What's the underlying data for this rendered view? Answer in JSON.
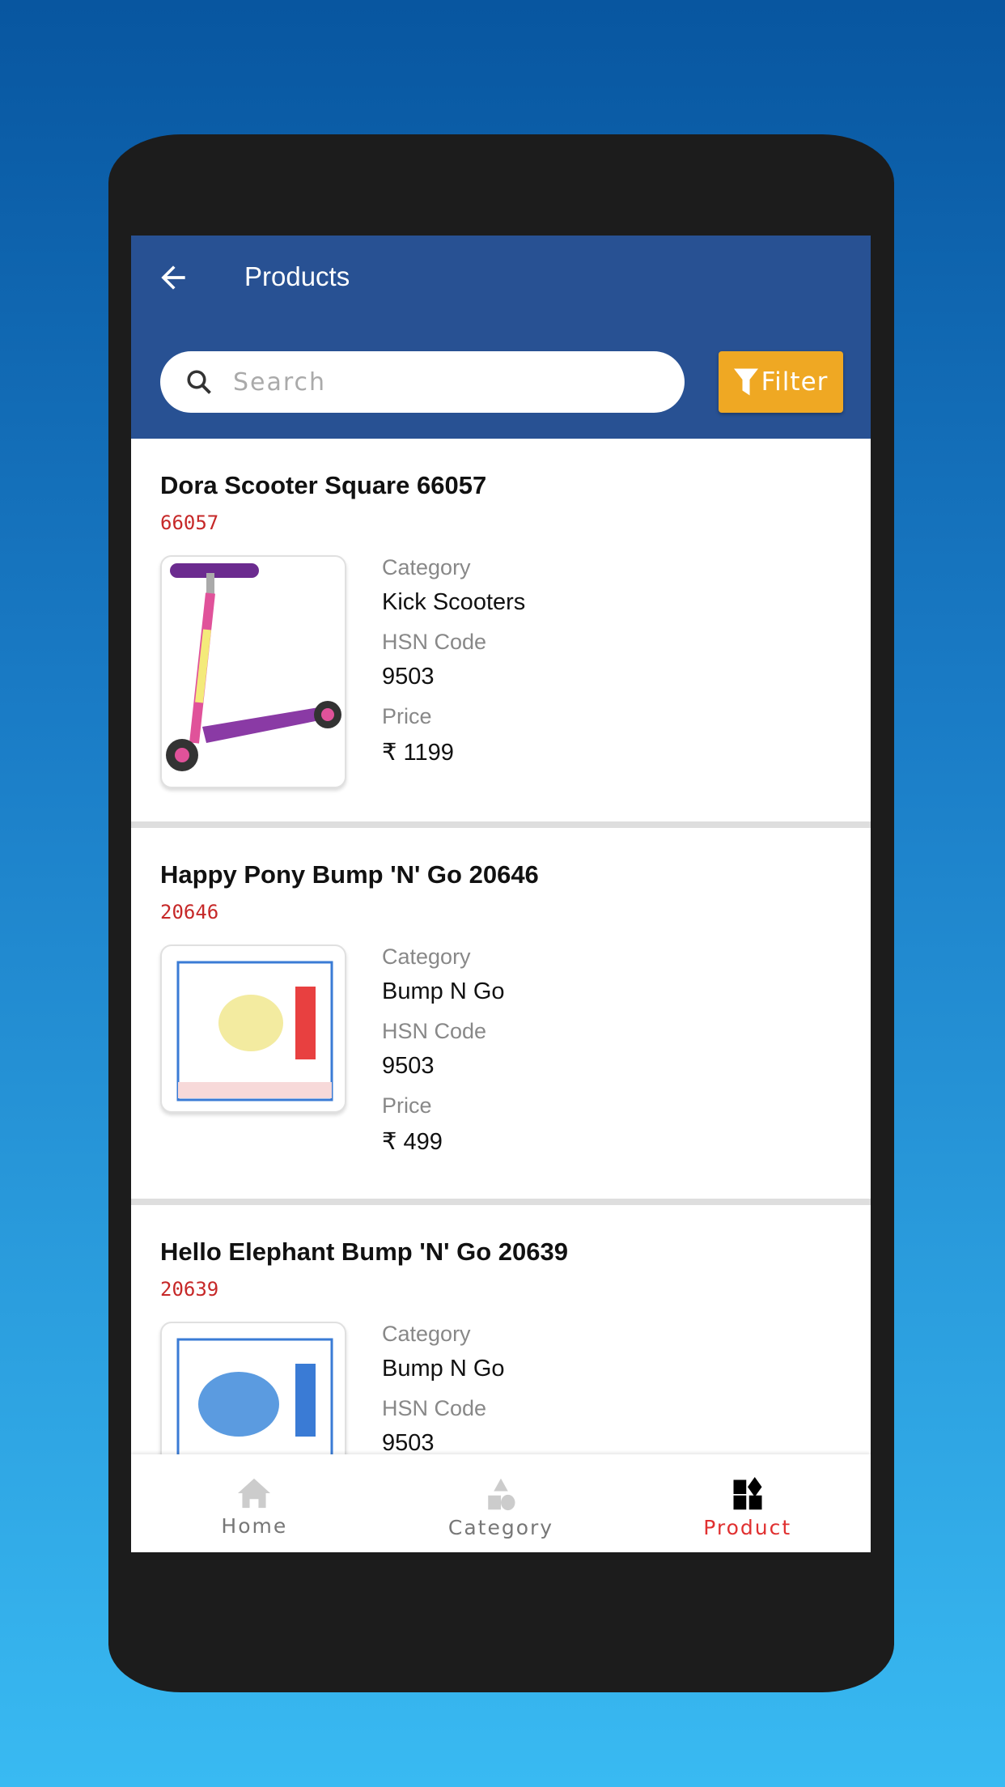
{
  "header": {
    "title": "Products",
    "back_icon": "arrow-left-icon"
  },
  "search": {
    "placeholder": "Search",
    "value": ""
  },
  "filter": {
    "label": "Filter",
    "color": "#efa823"
  },
  "labels": {
    "category": "Category",
    "hsn": "HSN Code",
    "price": "Price"
  },
  "products": [
    {
      "name": "Dora Scooter Square 66057",
      "code": "66057",
      "category": "Kick Scooters",
      "hsn": "9503",
      "price": "₹ 1199"
    },
    {
      "name": "Happy Pony Bump 'N' Go 20646",
      "code": "20646",
      "category": "Bump N Go",
      "hsn": "9503",
      "price": "₹ 499"
    },
    {
      "name": "Hello Elephant Bump 'N' Go 20639",
      "code": "20639",
      "category": "Bump N Go",
      "hsn": "9503",
      "price": ""
    }
  ],
  "nav": {
    "items": [
      {
        "label": "Home",
        "icon": "home-icon"
      },
      {
        "label": "Category",
        "icon": "shapes-icon"
      },
      {
        "label": "Product",
        "icon": "widgets-icon",
        "active": true
      }
    ]
  },
  "colors": {
    "appbar": "#285193",
    "active": "#e03030",
    "code": "#c62828"
  }
}
